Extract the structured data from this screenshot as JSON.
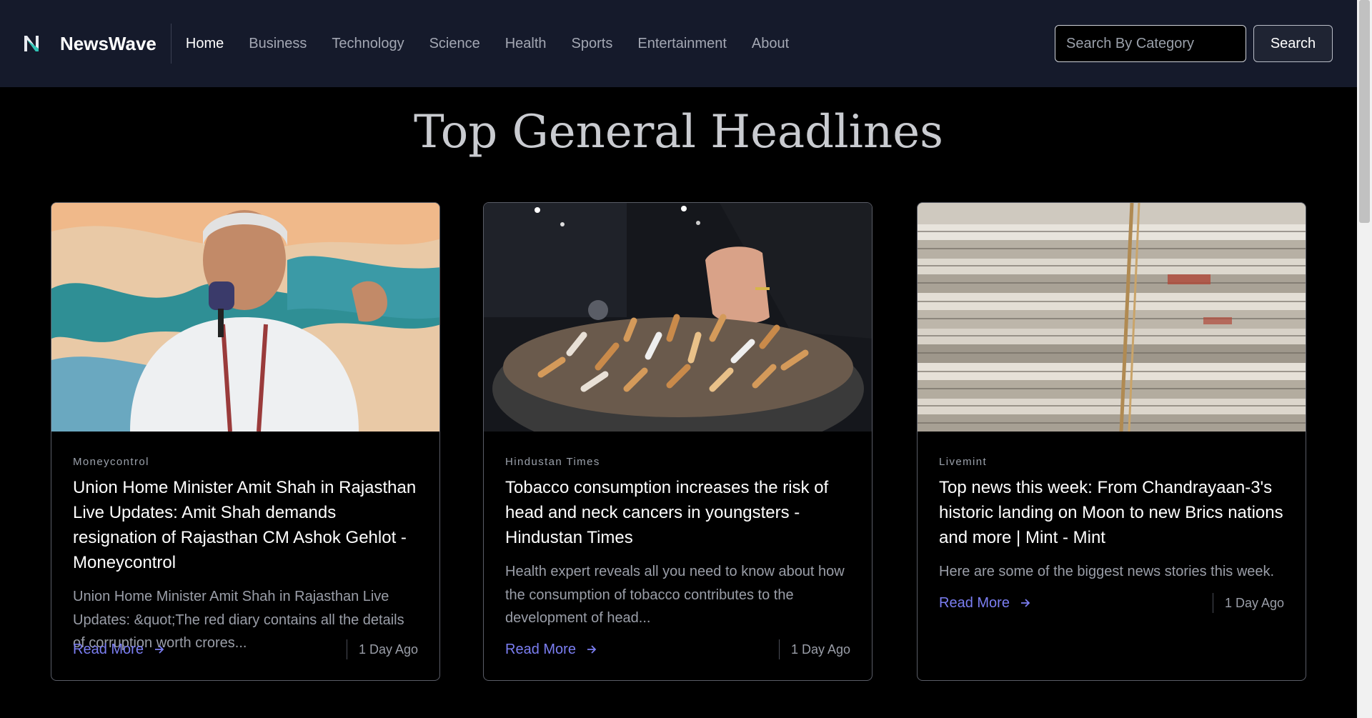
{
  "brand": {
    "name": "NewsWave",
    "logo_letter": "N"
  },
  "nav": {
    "links": [
      "Home",
      "Business",
      "Technology",
      "Science",
      "Health",
      "Sports",
      "Entertainment",
      "About"
    ],
    "active": "Home"
  },
  "search": {
    "placeholder": "Search By Category",
    "button_label": "Search"
  },
  "page": {
    "title": "Top General Headlines"
  },
  "articles": [
    {
      "source": "Moneycontrol",
      "title": "Union Home Minister Amit Shah in Rajasthan Live Updates: Amit Shah demands resignation of Rajasthan CM Ashok Gehlot - Moneycontrol",
      "description": "Union Home Minister Amit Shah in Rajasthan Live Updates: &quot;The red diary contains all the details of corruption worth crores...",
      "read_more": "Read More",
      "time": "1 Day Ago"
    },
    {
      "source": "Hindustan Times",
      "title": "Tobacco consumption increases the risk of head and neck cancers in youngsters - Hindustan Times",
      "description": "Health expert reveals all you need to know about how the consumption of tobacco contributes to the development of head...",
      "read_more": "Read More",
      "time": "1 Day Ago"
    },
    {
      "source": "Livemint",
      "title": "Top news this week: From Chandrayaan-3's historic landing on Moon to new Brics nations and more | Mint - Mint",
      "description": "Here are some of the biggest news stories this week.",
      "read_more": "Read More",
      "time": "1 Day Ago"
    }
  ],
  "colors": {
    "navbar_bg": "#151a2b",
    "accent_link": "#7b7ef2",
    "page_bg": "#000000"
  }
}
